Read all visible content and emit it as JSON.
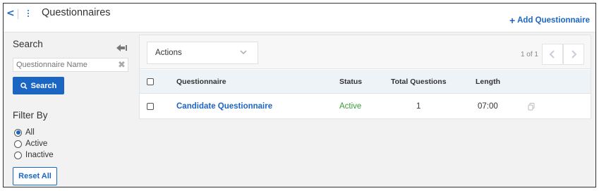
{
  "header": {
    "title": "Questionnaires",
    "add_label": "Add Questionnaire"
  },
  "sidebar": {
    "search_title": "Search",
    "search_placeholder": "Questionnaire Name",
    "search_button": "Search",
    "filter_title": "Filter By",
    "filters": [
      {
        "label": "All",
        "selected": true
      },
      {
        "label": "Active",
        "selected": false
      },
      {
        "label": "Inactive",
        "selected": false
      }
    ],
    "reset_button": "Reset All"
  },
  "toolbar": {
    "actions_label": "Actions",
    "pagination": "1 of 1"
  },
  "table": {
    "columns": [
      "Questionnaire",
      "Status",
      "Total Questions",
      "Length"
    ],
    "rows": [
      {
        "name": "Candidate Questionnaire",
        "status": "Active",
        "total_questions": "1",
        "length": "07:00"
      }
    ]
  },
  "colors": {
    "accent": "#1c66c3",
    "active_status": "#3a9d3a",
    "panel_bg": "#f2f2f2"
  }
}
